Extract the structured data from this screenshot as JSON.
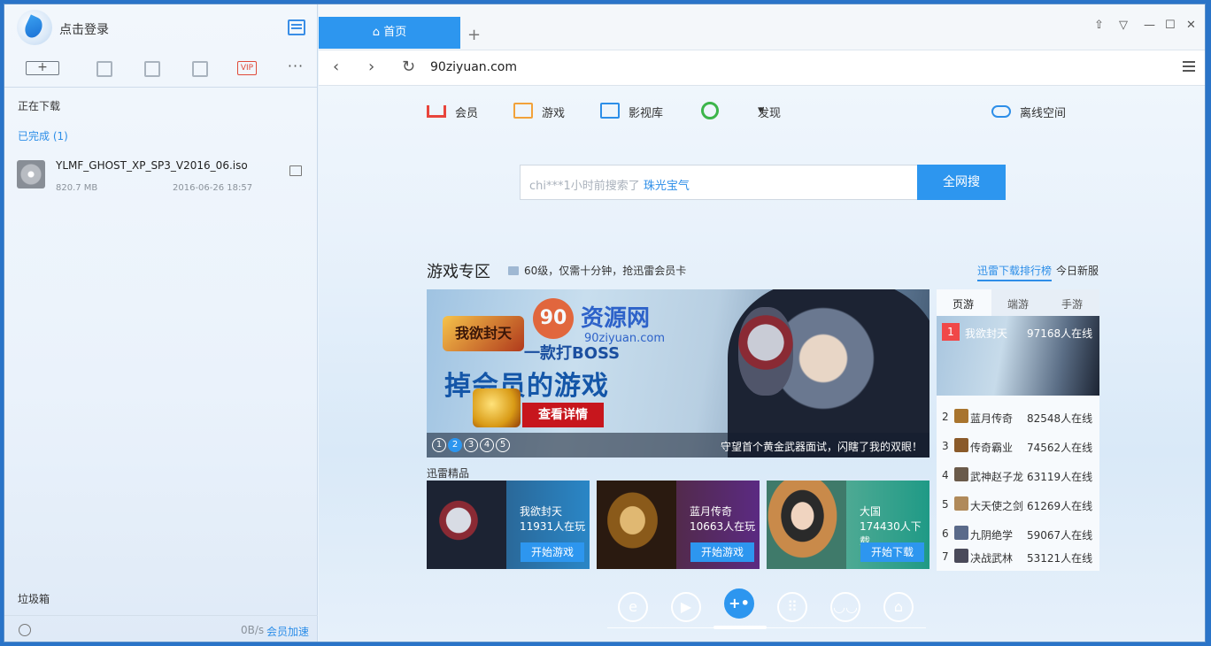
{
  "sidebar": {
    "login_label": "点击登录",
    "new_task_label": "+",
    "vip_label": "VIP",
    "more_label": "···",
    "downloading_label": "正在下载",
    "completed_label": "已完成 (1)",
    "file": {
      "name": "YLMF_GHOST_XP_SP3_V2016_06.iso",
      "size": "820.7 MB",
      "date": "2016-06-26 18:57"
    },
    "trash_label": "垃圾箱",
    "speed": "0B/s",
    "vip_speed_label": "会员加速"
  },
  "browser": {
    "tab_label": "首页",
    "new_tab_label": "+",
    "window_controls": [
      "⇧",
      "▽",
      "—",
      "☐",
      "✕"
    ],
    "nav_back": "‹",
    "nav_forward": "›",
    "nav_refresh": "↻",
    "url": "90ziyuan.com"
  },
  "channels": [
    {
      "label": "会员",
      "icon": "crown-icon",
      "color": "#e8453c"
    },
    {
      "label": "游戏",
      "icon": "game-icon",
      "color": "#f2a23a"
    },
    {
      "label": "影视库",
      "icon": "video-library-icon",
      "color": "#2d8ee8"
    },
    {
      "label": "发现",
      "icon": "discover-icon",
      "color": "#3cb54a"
    },
    {
      "label": "离线空间",
      "icon": "cloud-icon",
      "color": "#2d8ee8"
    }
  ],
  "discover_arrow": "▾",
  "search": {
    "hint_prefix": "chi***1小时前搜索了 ",
    "hint_keyword": "珠光宝气",
    "button_label": "全网搜"
  },
  "game_zone": {
    "title": "游戏专区",
    "promo": "60级，仅需十分钟，抢迅雷会员卡",
    "tab_rank": "迅雷下载排行榜",
    "tab_new": "今日新服",
    "banner": {
      "logo_text": "我欲封天",
      "line1": "一款打BOSS",
      "line2": "掉会员的游戏",
      "cta": "查看详情",
      "watermark_badge": "90",
      "watermark_cn": "资源网",
      "watermark_url": "90ziyuan.com",
      "caption": "守望首个黄金武器面试，闪瞎了我的双眼！",
      "pages": [
        "1",
        "2",
        "3",
        "4",
        "5"
      ],
      "active_page": 2
    },
    "section_label": "迅雷精品",
    "cards": [
      {
        "title": "我欲封天",
        "count": "11931人在玩",
        "button": "开始游戏",
        "bg": "#2a86c6"
      },
      {
        "title": "蓝月传奇",
        "count": "10663人在玩",
        "button": "开始游戏",
        "bg": "#5b2a82"
      },
      {
        "title": "大国",
        "count": "174430人下载",
        "button": "开始下载",
        "bg": "#1f9a86"
      }
    ],
    "rank_tabs": [
      "页游",
      "端游",
      "手游"
    ],
    "ranking": [
      {
        "rank": "1",
        "name": "我欲封天",
        "count": "97168人在线"
      },
      {
        "rank": "2",
        "name": "蓝月传奇",
        "count": "82548人在线"
      },
      {
        "rank": "3",
        "name": "传奇霸业",
        "count": "74562人在线"
      },
      {
        "rank": "4",
        "name": "武神赵子龙",
        "count": "63119人在线"
      },
      {
        "rank": "5",
        "name": "大天使之剑",
        "count": "61269人在线"
      },
      {
        "rank": "6",
        "name": "九阴绝学",
        "count": "59067人在线"
      },
      {
        "rank": "7",
        "name": "决战武林",
        "count": "53121人在线"
      }
    ]
  },
  "dock": [
    "e",
    "▶",
    "+•",
    "⠿",
    "◡◡",
    "⌂"
  ]
}
